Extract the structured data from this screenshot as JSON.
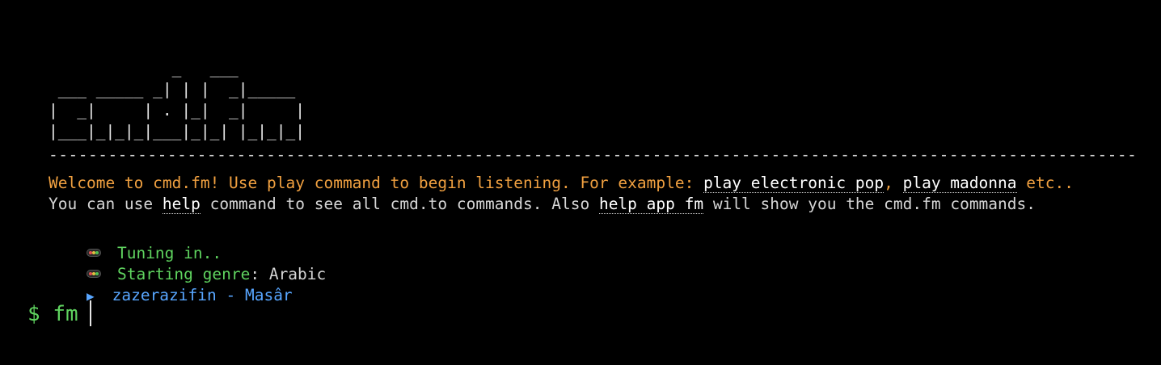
{
  "logo": {
    "ascii": "             _   ___\n ___ _____ _| | |  _|_____\n|  _|     | . |_|  _|     |\n|___|_|_|_|___|_|_| |_|_|_|"
  },
  "separator": "--------------------------------------------------------------------------------------------------------------------------------------------",
  "welcome": {
    "prefix": "Welcome to cmd.fm! Use play command to begin listening. For example: ",
    "example1": "play electronic pop",
    "comma": ", ",
    "example2": "play madonna",
    "suffix": " etc.."
  },
  "help_line": {
    "prefix": "You can use ",
    "help_cmd": "help",
    "middle": " command to see all cmd.to commands. Also ",
    "help_app_cmd": "help app fm",
    "suffix": " will show you the cmd.fm commands."
  },
  "status": {
    "tuning": "Tuning in..",
    "genre_label": "Starting genre",
    "genre_sep": ": ",
    "genre_value": "Arabic"
  },
  "now_playing": {
    "icon": "play-triangle-icon",
    "track": "zazerazifin - Masâr"
  },
  "prompt": {
    "symbol": "$",
    "input": "fm"
  },
  "colors": {
    "background": "#000000",
    "orange": "#f0a040",
    "green": "#5fd35f",
    "blue": "#58a6ff",
    "text": "#d6d6d6"
  }
}
